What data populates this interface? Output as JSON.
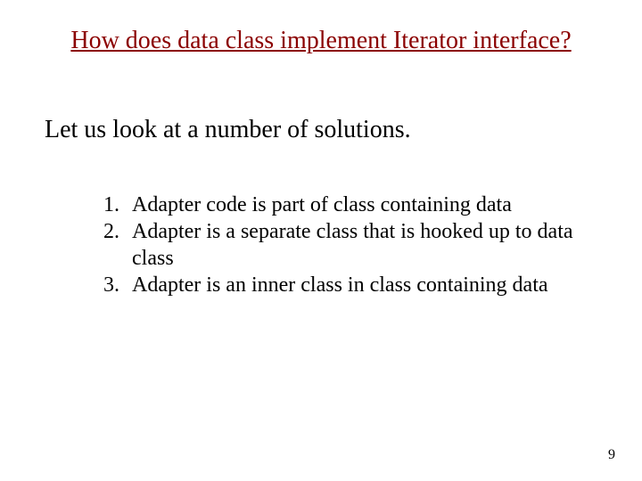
{
  "title": "How does data class implement Iterator interface?",
  "subtitle": "Let us look at a number of solutions.",
  "items": [
    "Adapter code is part of class containing data",
    "Adapter is a separate class that is hooked up to data class",
    "Adapter is an inner class in class containing data"
  ],
  "page_number": "9"
}
